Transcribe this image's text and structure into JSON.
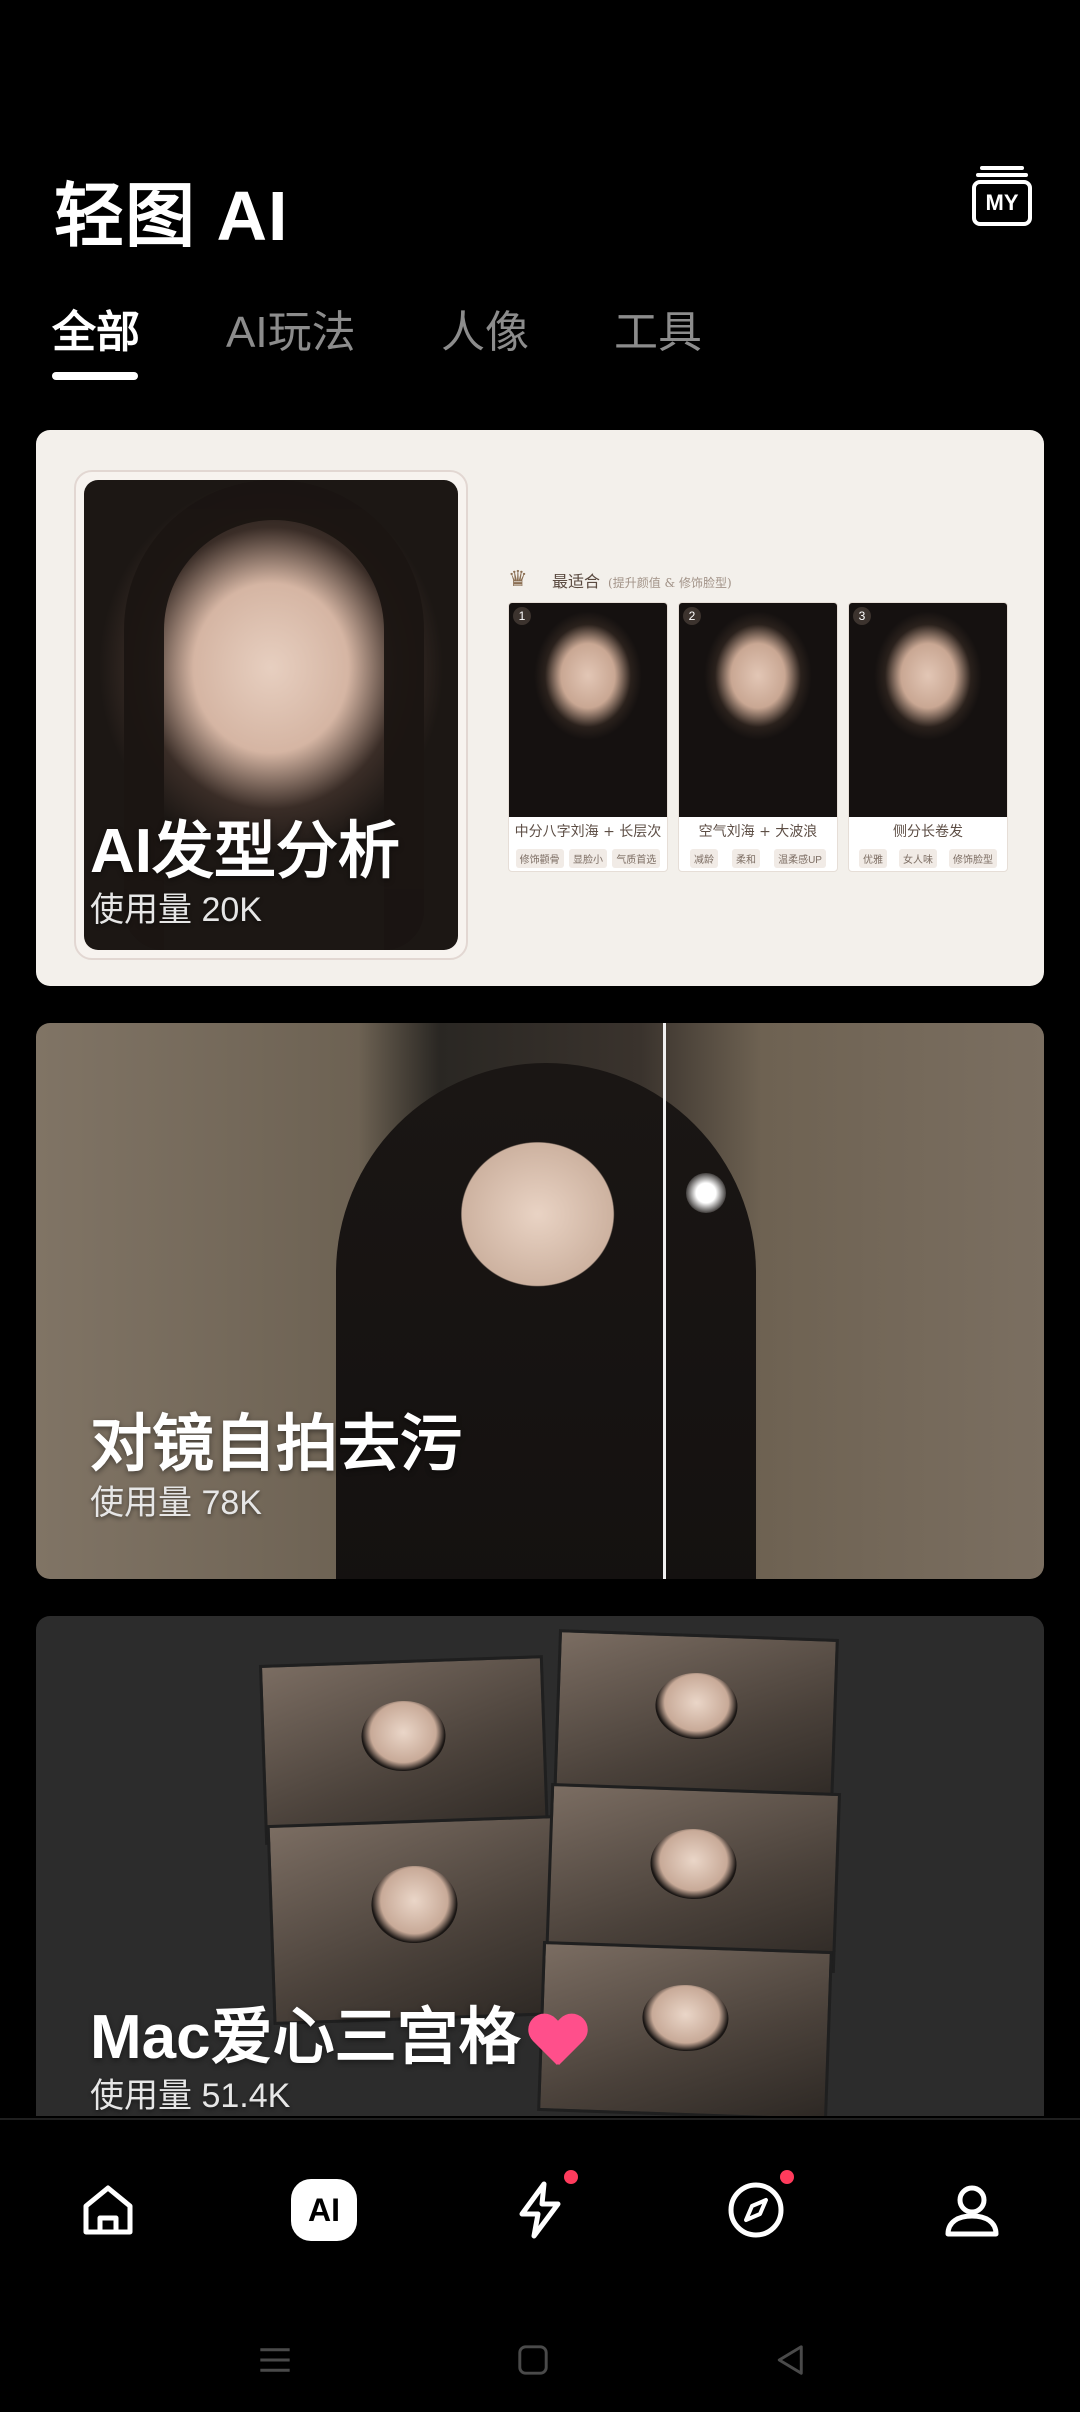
{
  "header": {
    "app_title": "轻图 AI",
    "my_button_label": "MY"
  },
  "tabs": [
    {
      "label": "全部",
      "active": true
    },
    {
      "label": "AI玩法",
      "active": false
    },
    {
      "label": "人像",
      "active": false
    },
    {
      "label": "工具",
      "active": false
    }
  ],
  "cards": [
    {
      "title": "AI发型分析",
      "usage_label": "使用量",
      "usage_count": "20K",
      "preview": {
        "header": "最适合",
        "subheader": "(提升颜值 & 修饰脸型)",
        "styles": [
          {
            "num": "1",
            "caption": "中分八字刘海 + 长层次",
            "tags": [
              "修饰颧骨",
              "显脸小",
              "气质首选"
            ]
          },
          {
            "num": "2",
            "caption": "空气刘海 + 大波浪",
            "tags": [
              "减龄",
              "柔和",
              "温柔感UP"
            ]
          },
          {
            "num": "3",
            "caption": "侧分长卷发",
            "tags": [
              "优雅",
              "女人味",
              "修饰脸型"
            ]
          }
        ]
      }
    },
    {
      "title": "对镜自拍去污",
      "usage_label": "使用量",
      "usage_count": "78K"
    },
    {
      "title": "Mac爱心三宫格",
      "title_emoji": "pink-heart",
      "usage_label": "使用量",
      "usage_count": "51.4K"
    }
  ],
  "bottom_nav": [
    {
      "name": "home",
      "icon": "home-icon"
    },
    {
      "name": "ai",
      "label": "AI",
      "active": true
    },
    {
      "name": "flash",
      "icon": "lightning-icon",
      "badge": true
    },
    {
      "name": "discover",
      "icon": "compass-icon",
      "badge": true
    },
    {
      "name": "profile",
      "icon": "user-icon"
    }
  ],
  "colors": {
    "background": "#000000",
    "card1_bg": "#f3f0eb",
    "card3_bg": "#2c2c2c",
    "tab_inactive": "#8c8c8c",
    "badge": "#ff3b5c",
    "heart": "#ff4f8b"
  }
}
